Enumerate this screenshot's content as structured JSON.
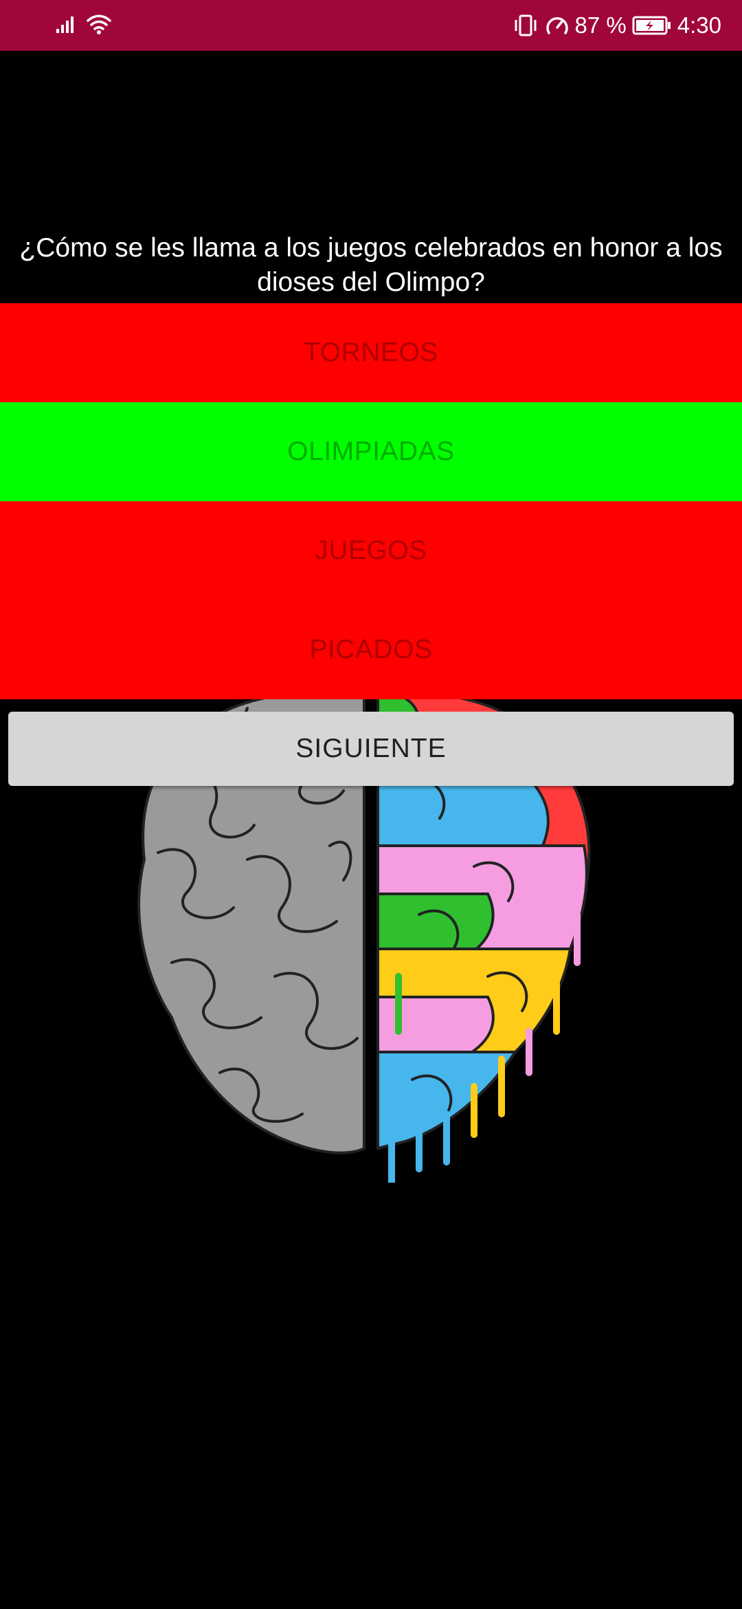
{
  "status_bar": {
    "battery": "87 %",
    "time": "4:30",
    "background": "#A0063C",
    "icons": [
      "signal-icon",
      "wifi-icon",
      "vibrate-icon",
      "data-saver-icon",
      "battery-charging-icon"
    ]
  },
  "quiz": {
    "question": "¿Cómo se les llama a los juegos celebrados en honor a los dioses del Olimpo?",
    "answers": [
      {
        "label": "TORNEOS",
        "color": "#FF0000",
        "state": "incorrect"
      },
      {
        "label": "OLIMPIADAS",
        "color": "#00FF00",
        "state": "correct"
      },
      {
        "label": "JUEGOS",
        "color": "#FF0000",
        "state": "incorrect"
      },
      {
        "label": "PICADOS",
        "color": "#FF0000",
        "state": "incorrect"
      }
    ],
    "next_label": "SIGUIENTE"
  },
  "background_image": "brain-illustration"
}
